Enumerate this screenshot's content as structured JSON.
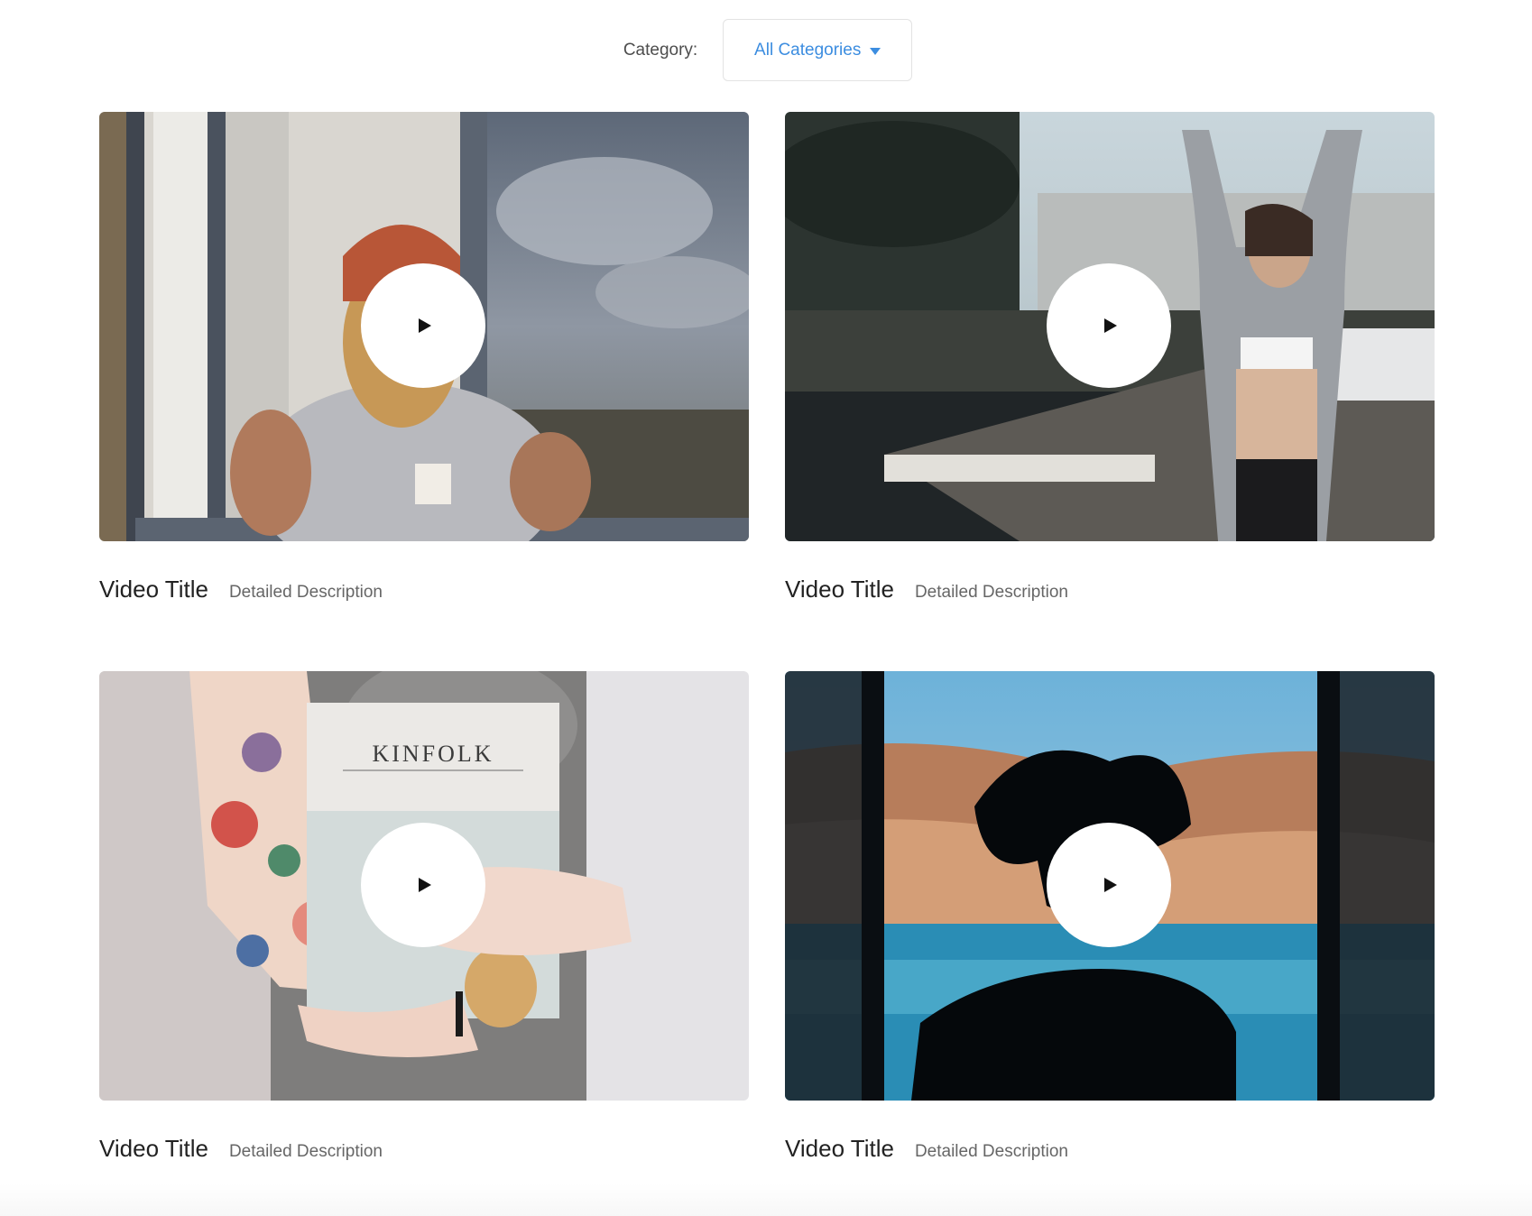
{
  "filter": {
    "label": "Category:",
    "selected": "All Categories",
    "caret_icon": "chevron-down-icon",
    "accent_color": "#3c8de0"
  },
  "videos": [
    {
      "title": "Video Title",
      "description": "Detailed Description",
      "thumbnail": "man in beanie at window"
    },
    {
      "title": "Video Title",
      "description": "Detailed Description",
      "thumbnail": "woman stretching on dock"
    },
    {
      "title": "Video Title",
      "description": "Detailed Description",
      "thumbnail": "tattooed arms holding KINFOLK magazine",
      "thumbnail_text": "KINFOLK"
    },
    {
      "title": "Video Title",
      "description": "Detailed Description",
      "thumbnail": "silhouette in hat against lake"
    }
  ],
  "play_icon": "play-icon"
}
